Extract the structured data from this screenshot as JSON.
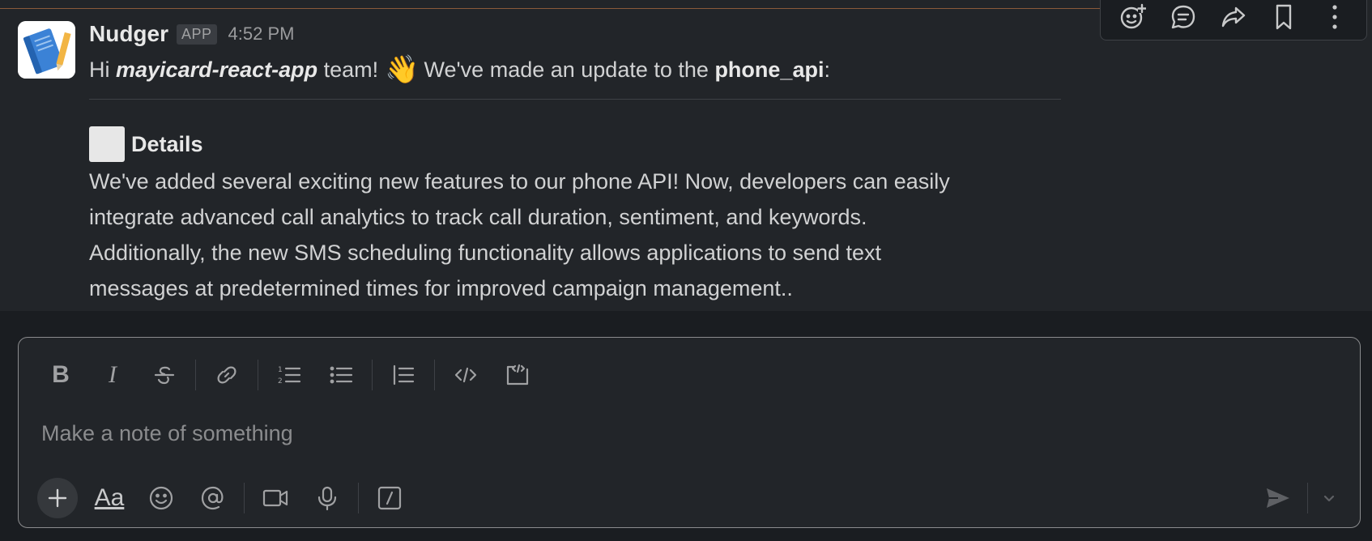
{
  "message": {
    "sender": "Nudger",
    "badge": "APP",
    "time": "4:52 PM",
    "greeting_hi": "Hi",
    "team_name": "mayicard-react-app",
    "greeting_team": "team!",
    "wave_emoji": "👋",
    "update_text": "We've made an update to the",
    "api_name": "phone_api",
    "api_suffix": ":",
    "details_title": "Details",
    "details_lines": [
      "We've added several exciting new features to our phone API!  Now, developers can easily",
      "integrate advanced call analytics to track call duration, sentiment, and keywords.",
      "Additionally, the new SMS scheduling functionality allows applications to send text",
      "messages at predetermined times for improved campaign management.."
    ]
  },
  "hover_toolbar": {
    "icons": [
      "add-reaction-icon",
      "reply-in-thread-icon",
      "share-icon",
      "bookmark-icon",
      "more-actions-icon"
    ]
  },
  "composer": {
    "placeholder": "Make a note of something",
    "format_bold": "B",
    "format_italic": "I",
    "text_format_label": "Aa"
  },
  "colors": {
    "background": "#1a1d21",
    "message_bg": "#222529",
    "text": "#d1d2d3",
    "muted": "#a0a1a3"
  }
}
